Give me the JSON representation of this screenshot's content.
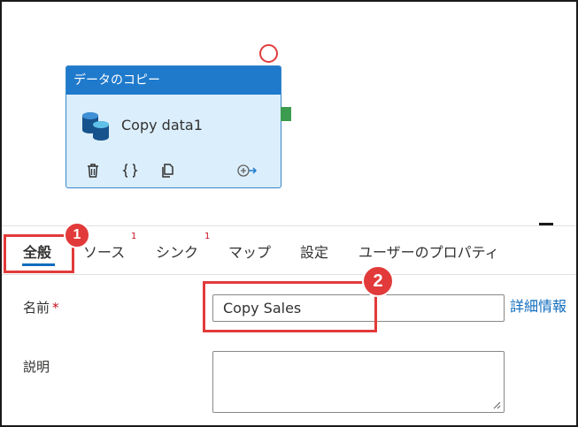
{
  "activity": {
    "type_label": "データのコピー",
    "name": "Copy data1"
  },
  "tabs": [
    {
      "label": "全般",
      "badge": ""
    },
    {
      "label": "ソース",
      "badge": "1"
    },
    {
      "label": "シンク",
      "badge": "1"
    },
    {
      "label": "マップ",
      "badge": ""
    },
    {
      "label": "設定",
      "badge": ""
    },
    {
      "label": "ユーザーのプロパティ",
      "badge": ""
    }
  ],
  "form": {
    "name_label": "名前",
    "name_required_mark": "*",
    "name_value": "Copy Sales",
    "more_info_label": "詳細情報",
    "description_label": "説明",
    "description_value": ""
  },
  "callouts": [
    "1",
    "2"
  ],
  "colors": {
    "activity_header": "#1f7acc",
    "activity_body": "#dbeefb",
    "success_port": "#3b9b4e",
    "callout": "#e23a3a",
    "link": "#0f6cbd"
  }
}
